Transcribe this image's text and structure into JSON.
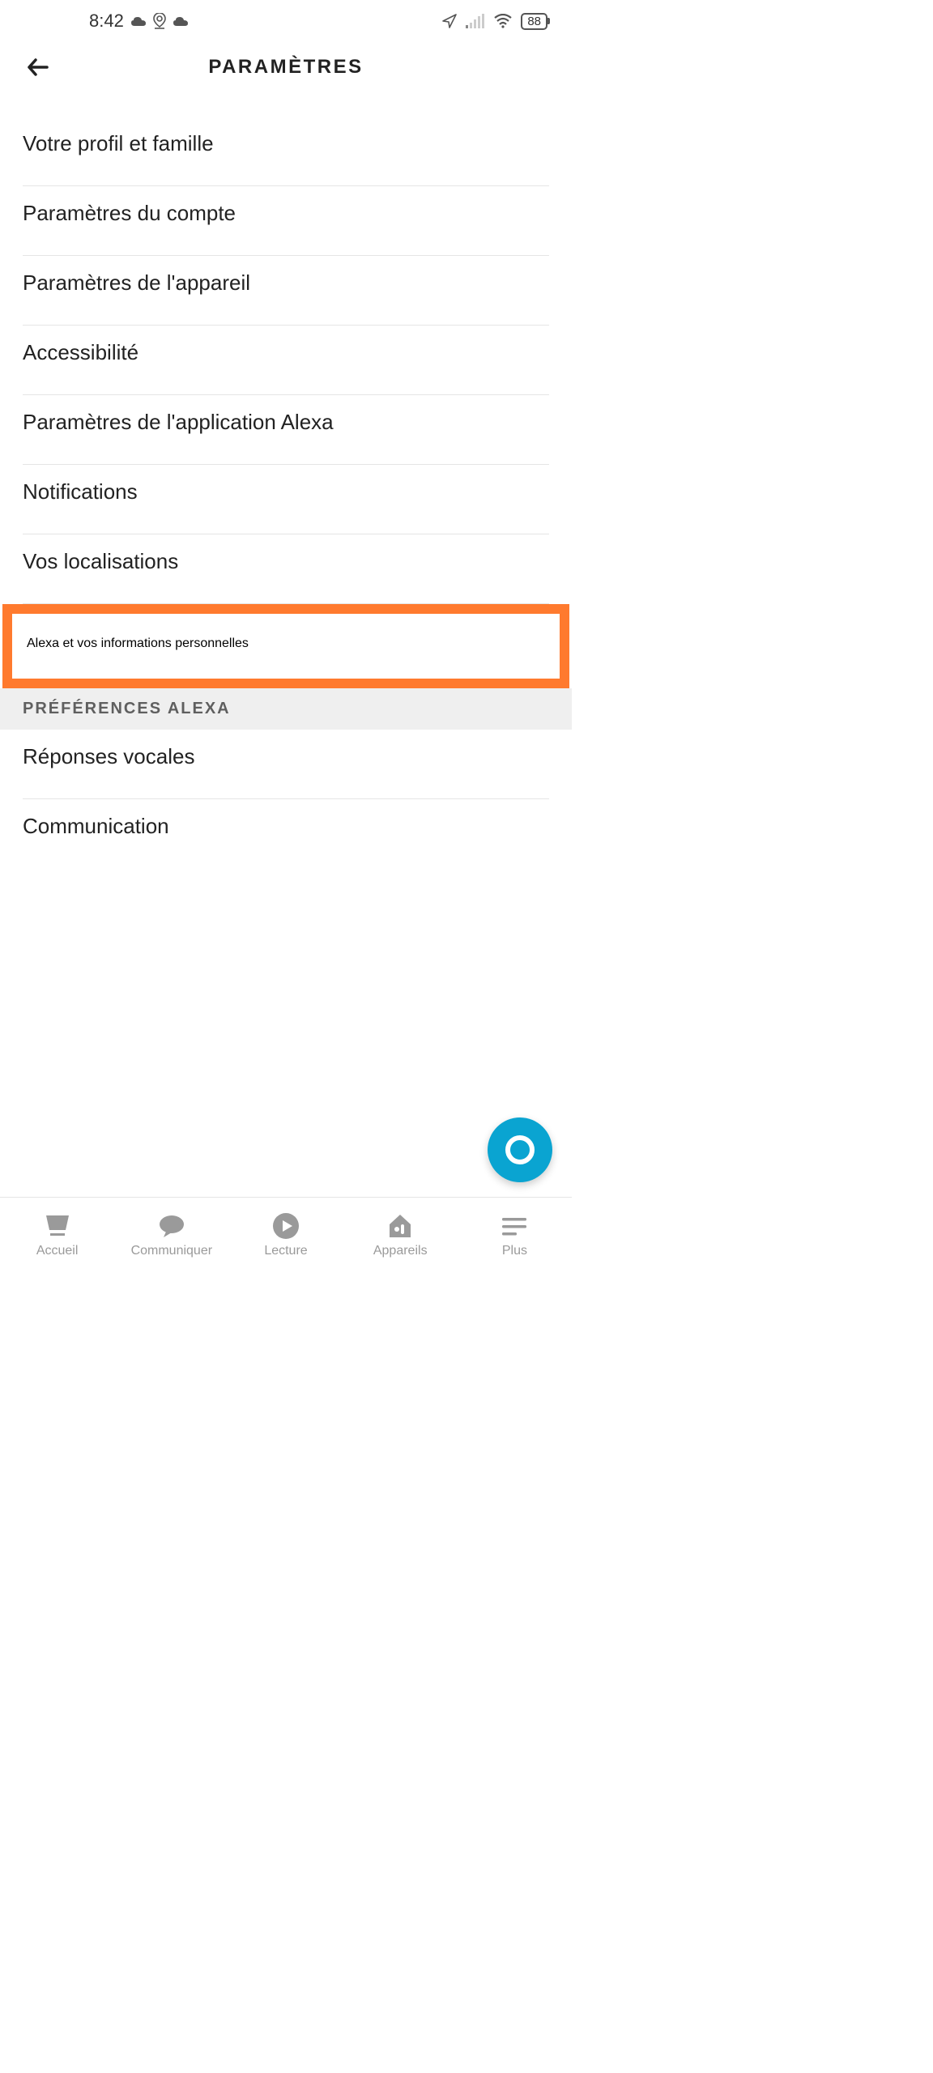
{
  "status": {
    "time": "8:42",
    "battery": "88"
  },
  "header": {
    "title": "PARAMÈTRES"
  },
  "settings": {
    "items": [
      {
        "label": "Votre profil et famille"
      },
      {
        "label": "Paramètres du compte"
      },
      {
        "label": "Paramètres de l'appareil"
      },
      {
        "label": "Accessibilité"
      },
      {
        "label": "Paramètres de l'application Alexa"
      },
      {
        "label": "Notifications"
      },
      {
        "label": "Vos localisations"
      },
      {
        "label": "Alexa et vos informations personnelles",
        "highlighted": true
      }
    ],
    "section_header": "PRÉFÉRENCES ALEXA",
    "section_items": [
      {
        "label": "Réponses vocales"
      },
      {
        "label": "Communication"
      }
    ]
  },
  "nav": {
    "items": [
      {
        "label": "Accueil"
      },
      {
        "label": "Communiquer"
      },
      {
        "label": "Lecture"
      },
      {
        "label": "Appareils"
      },
      {
        "label": "Plus"
      }
    ]
  },
  "colors": {
    "highlight": "#ff7a2e",
    "fab": "#0aa4d1"
  }
}
